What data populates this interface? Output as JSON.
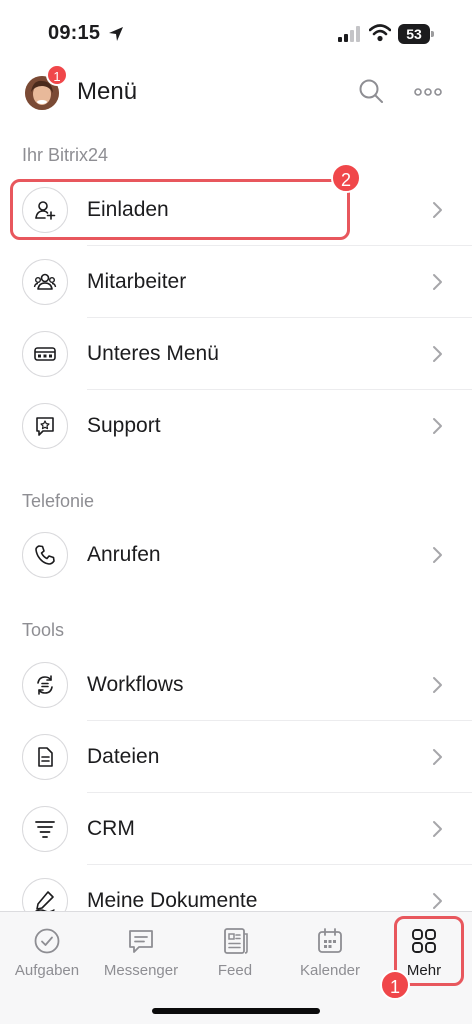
{
  "status": {
    "time": "09:15",
    "battery": "53"
  },
  "header": {
    "title": "Menü",
    "avatar_badge": "1"
  },
  "sections": [
    {
      "title": "Ihr Bitrix24"
    },
    {
      "title": "Telefonie"
    },
    {
      "title": "Tools"
    }
  ],
  "items": [
    {
      "label": "Einladen",
      "icon": "add-user-icon"
    },
    {
      "label": "Mitarbeiter",
      "icon": "people-icon"
    },
    {
      "label": "Unteres Menü",
      "icon": "bottom-menu-icon"
    },
    {
      "label": "Support",
      "icon": "support-chat-icon"
    },
    {
      "label": "Anrufen",
      "icon": "phone-icon"
    },
    {
      "label": "Workflows",
      "icon": "workflow-icon"
    },
    {
      "label": "Dateien",
      "icon": "file-icon"
    },
    {
      "label": "CRM",
      "icon": "crm-funnel-icon"
    },
    {
      "label": "Meine Dokumente",
      "icon": "sign-document-icon"
    }
  ],
  "tabs": [
    {
      "label": "Aufgaben",
      "icon": "check-circle-icon"
    },
    {
      "label": "Messenger",
      "icon": "chat-icon"
    },
    {
      "label": "Feed",
      "icon": "feed-icon"
    },
    {
      "label": "Kalender",
      "icon": "calendar-icon"
    },
    {
      "label": "Mehr",
      "icon": "grid-icon"
    }
  ],
  "annotations": {
    "step1": "1",
    "step2": "2"
  },
  "colors": {
    "accent_red": "#e8575d",
    "badge_red": "#f0474a",
    "muted_text": "#8e8e93"
  }
}
